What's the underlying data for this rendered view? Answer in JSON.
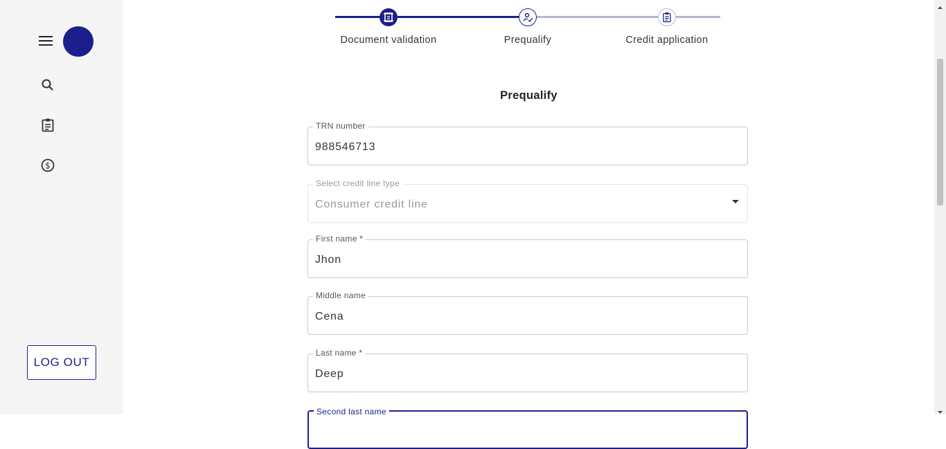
{
  "sidebar": {
    "logout_label": "LOG OUT",
    "icons": [
      "menu-icon",
      "search-icon",
      "clipboard-icon",
      "dollar-icon"
    ],
    "avatar_color": "#1a1f8c"
  },
  "stepper": {
    "steps": [
      {
        "label": "Document validation",
        "icon": "document-icon",
        "state": "completed"
      },
      {
        "label": "Prequalify",
        "icon": "signature-icon",
        "state": "active"
      },
      {
        "label": "Credit application",
        "icon": "clipboard-icon",
        "state": "pending"
      }
    ],
    "accent": "#1a1f8c",
    "pending_color": "#b3b6d6"
  },
  "form": {
    "title": "Prequalify",
    "fields": [
      {
        "label": "TRN number",
        "value": "988546713"
      },
      {
        "label": "Select credit line type",
        "value": "Consumer credit line",
        "type": "select",
        "disabled": true
      },
      {
        "label": "First name *",
        "value": "Jhon"
      },
      {
        "label": "Middle name",
        "value": "Cena"
      },
      {
        "label": "Last name *",
        "value": "Deep"
      },
      {
        "label": "Second last name",
        "value": "",
        "focused": true
      }
    ]
  }
}
